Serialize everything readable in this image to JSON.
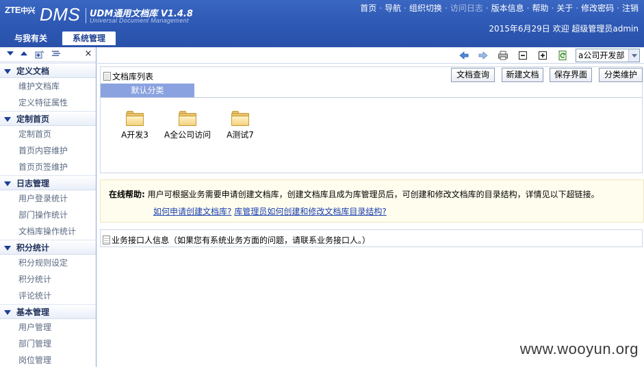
{
  "header": {
    "logo_brand": "ZTE",
    "logo_brand_cn": "中兴",
    "logo_app": "DMS",
    "product_name": "UDM通用文档库 V1.4.8",
    "product_name_en": "Universal Document Management",
    "top_nav": [
      "首页",
      "导航",
      "组织切换",
      "访问日志",
      "版本信息",
      "帮助",
      "关于",
      "修改密码",
      "注销"
    ],
    "status": "2015年6月29日 欢迎 超级管理员admin",
    "tabs": [
      {
        "label": "与我有关",
        "active": false
      },
      {
        "label": "系统管理",
        "active": true
      }
    ]
  },
  "sidebar": {
    "close_glyph": "×",
    "groups": [
      {
        "label": "定义文档",
        "items": [
          "维护文档库",
          "定义特征属性"
        ]
      },
      {
        "label": "定制首页",
        "items": [
          "定制首页",
          "首页内容维护",
          "首页页签维护"
        ]
      },
      {
        "label": "日志管理",
        "items": [
          "用户登录统计",
          "部门操作统计",
          "文档库操作统计"
        ]
      },
      {
        "label": "积分统计",
        "items": [
          "积分规则设定",
          "积分统计",
          "评论统计"
        ]
      },
      {
        "label": "基本管理",
        "items": [
          "用户管理",
          "部门管理",
          "岗位管理"
        ]
      }
    ]
  },
  "toolbar": {
    "icons": [
      "back-arrow-icon",
      "forward-arrow-icon",
      "print-icon",
      "collapse-icon",
      "expand-icon",
      "refresh-icon"
    ],
    "company_select": "a公司开发部"
  },
  "library": {
    "title": "文档库列表",
    "buttons": {
      "query": "文档查询",
      "new_doc": "新建文档",
      "save_view": "保存界面",
      "category": "分类维护"
    },
    "category_tab": "默认分类",
    "folders": [
      "A开发3",
      "A全公司访问",
      "A测试7"
    ]
  },
  "help": {
    "label": "在线帮助:",
    "text": "用户可根据业务需要申请创建文档库，创建文档库且成为库管理员后，可创建和修改文档库的目录结构，详情见以下超链接。",
    "links": [
      "如何申请创建文档库?",
      "库管理员如何创建和修改文档库目录结构?"
    ]
  },
  "contact": {
    "text": "业务接口人信息（如果您有系统业务方面的问题，请联系业务接口人。）"
  },
  "watermark": "www.wooyun.org",
  "colors": {
    "header": "#2c57b3",
    "category_tab": "#8aa2e0",
    "help_bg": "#fffdee",
    "link": "#1a3fb0"
  }
}
